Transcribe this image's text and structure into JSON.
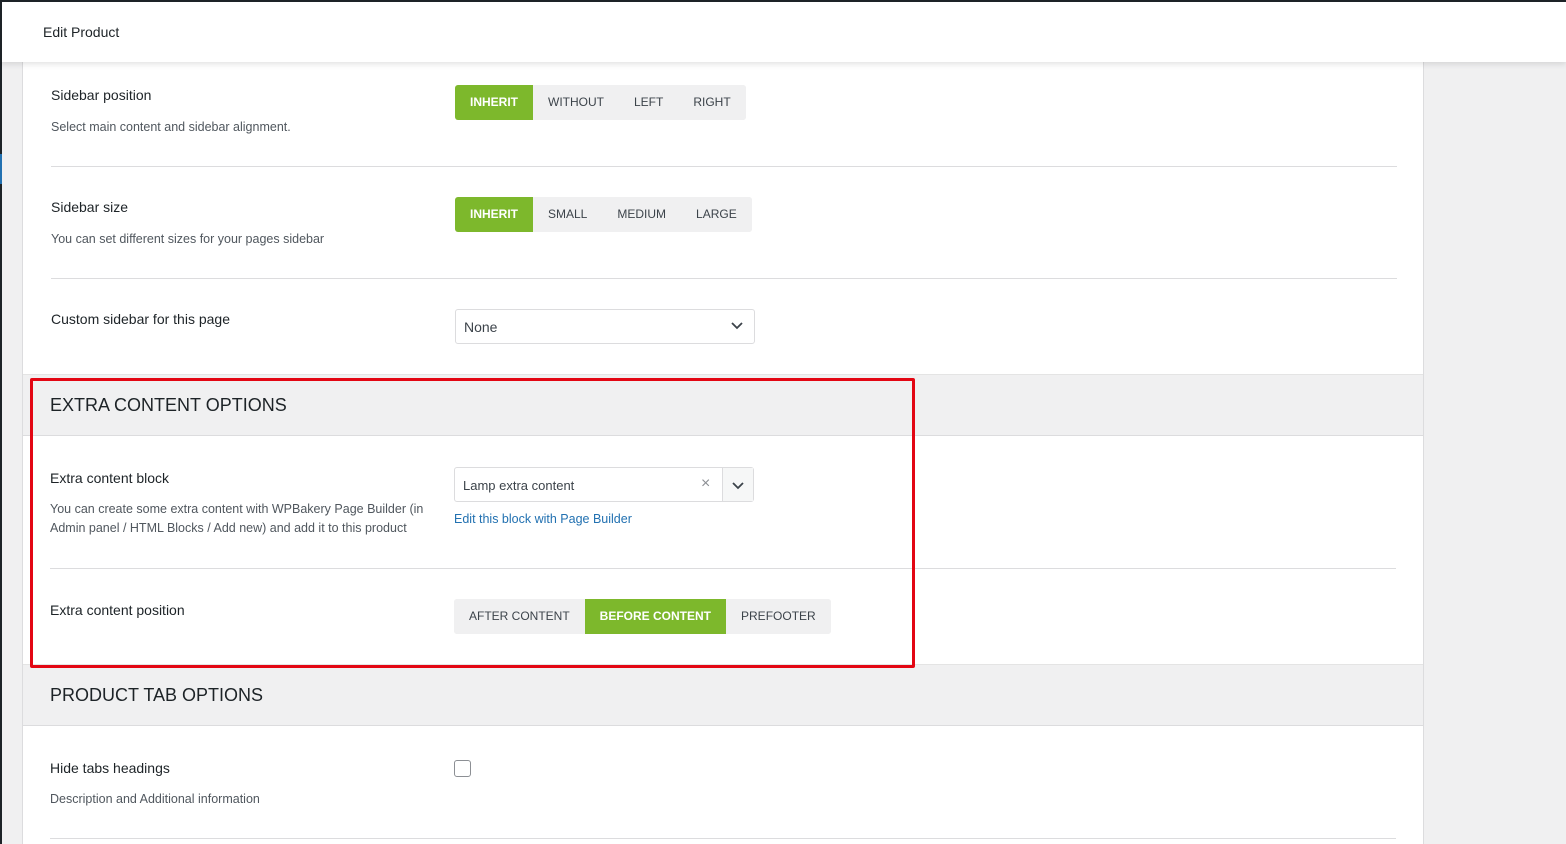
{
  "header": {
    "title": "Edit Product"
  },
  "sidebar_position": {
    "label": "Sidebar position",
    "description": "Select main content and sidebar alignment.",
    "options": [
      "INHERIT",
      "WITHOUT",
      "LEFT",
      "RIGHT"
    ],
    "selected": "INHERIT"
  },
  "sidebar_size": {
    "label": "Sidebar size",
    "description": "You can set different sizes for your pages sidebar",
    "options": [
      "INHERIT",
      "SMALL",
      "MEDIUM",
      "LARGE"
    ],
    "selected": "INHERIT"
  },
  "custom_sidebar": {
    "label": "Custom sidebar for this page",
    "value": "None"
  },
  "extra_content_section": {
    "title": "EXTRA CONTENT OPTIONS",
    "block": {
      "label": "Extra content block",
      "description": "You can create some extra content with WPBakery Page Builder (in Admin panel / HTML Blocks / Add new) and add it to this product",
      "value": "Lamp extra content",
      "clear_symbol": "×",
      "edit_link": "Edit this block with Page Builder"
    },
    "position": {
      "label": "Extra content position",
      "options": [
        "AFTER CONTENT",
        "BEFORE CONTENT",
        "PREFOOTER"
      ],
      "selected": "BEFORE CONTENT"
    }
  },
  "product_tab_section": {
    "title": "PRODUCT TAB OPTIONS",
    "hide_tabs": {
      "label": "Hide tabs headings",
      "description": "Description and Additional information",
      "checked": false
    }
  },
  "colors": {
    "accent_green": "#7db82c",
    "highlight_red": "#e30613",
    "link_blue": "#2271b1"
  }
}
